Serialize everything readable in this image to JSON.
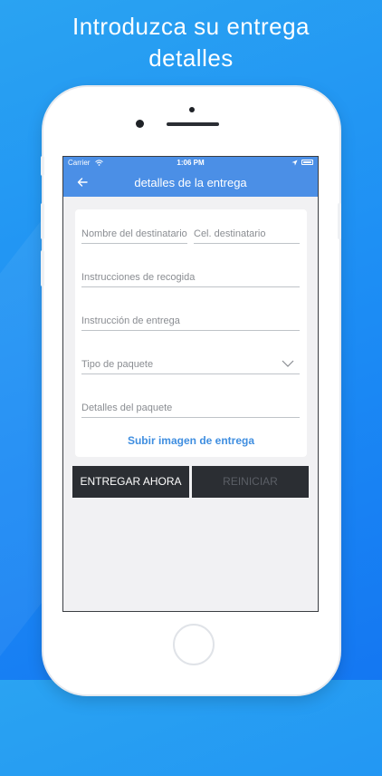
{
  "headline": {
    "line1": "Introduzca su entrega",
    "line2": "detalles"
  },
  "status_bar": {
    "carrier": "Carrier",
    "time": "1:06 PM"
  },
  "nav": {
    "title": "detalles de la entrega"
  },
  "form": {
    "recipient_name_placeholder": "Nombre del destinatario",
    "recipient_phone_placeholder": "Cel. destinatario",
    "pickup_instructions_placeholder": "Instrucciones de recogida",
    "delivery_instruction_placeholder": "Instrucción de entrega",
    "package_type_placeholder": "Tipo de paquete",
    "package_details_placeholder": "Detalles del paquete",
    "upload_label": "Subir imagen de entrega"
  },
  "actions": {
    "deliver_now_label": "ENTREGAR AHORA",
    "reset_label": "REINICIAR"
  },
  "colors": {
    "background": "#1c8cf4",
    "nav_bar": "#4b8fe6",
    "button_bg": "#2b2e33",
    "link": "#3f8ee0"
  },
  "icons": [
    "wifi-icon",
    "location-arrow-icon",
    "battery-icon",
    "back-arrow-icon",
    "chevron-down-icon"
  ]
}
